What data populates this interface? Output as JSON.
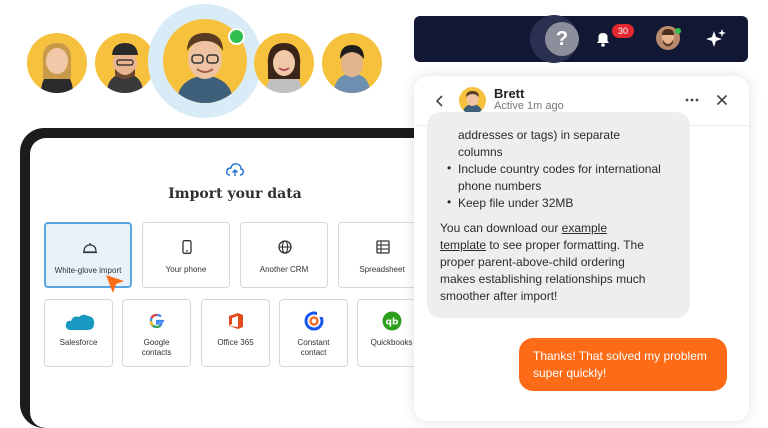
{
  "people": {
    "row_names": [
      "avatar-1",
      "avatar-2",
      "avatar-center",
      "avatar-4",
      "avatar-5"
    ]
  },
  "import": {
    "title": "Import your data",
    "tiles_row1": [
      "White-glove import",
      "Your phone",
      "Another CRM",
      "Spreadsheet"
    ],
    "tiles_row2": [
      "Salesforce",
      "Google\ncontacts",
      "Office 365",
      "Constant\ncontact",
      "Quickbooks"
    ],
    "selected": "White-glove import"
  },
  "topbar": {
    "help_glyph": "?",
    "notification_count": "30"
  },
  "chat": {
    "name": "Brett",
    "status": "Active 1m ago",
    "line1": "addresses or tags) in separate",
    "line2": "columns",
    "bullet1a": "Include country codes for international",
    "bullet1b": "phone numbers",
    "bullet2": "Keep file under 32MB",
    "p1": "You can download our ",
    "p1_link": "example",
    "p2_link": "template",
    "p2": " to see proper formatting. The",
    "p3": "proper parent-above-child ordering",
    "p4": "makes establishing relationships much",
    "p5": "smoother after import!",
    "reply_l1": "Thanks! That solved my problem",
    "reply_l2": "super quickly!"
  },
  "colors": {
    "accent_orange": "#fe6b16",
    "navy": "#121833",
    "selected_blue": "#5aa5df",
    "avatar_yellow": "#f6c23e"
  }
}
